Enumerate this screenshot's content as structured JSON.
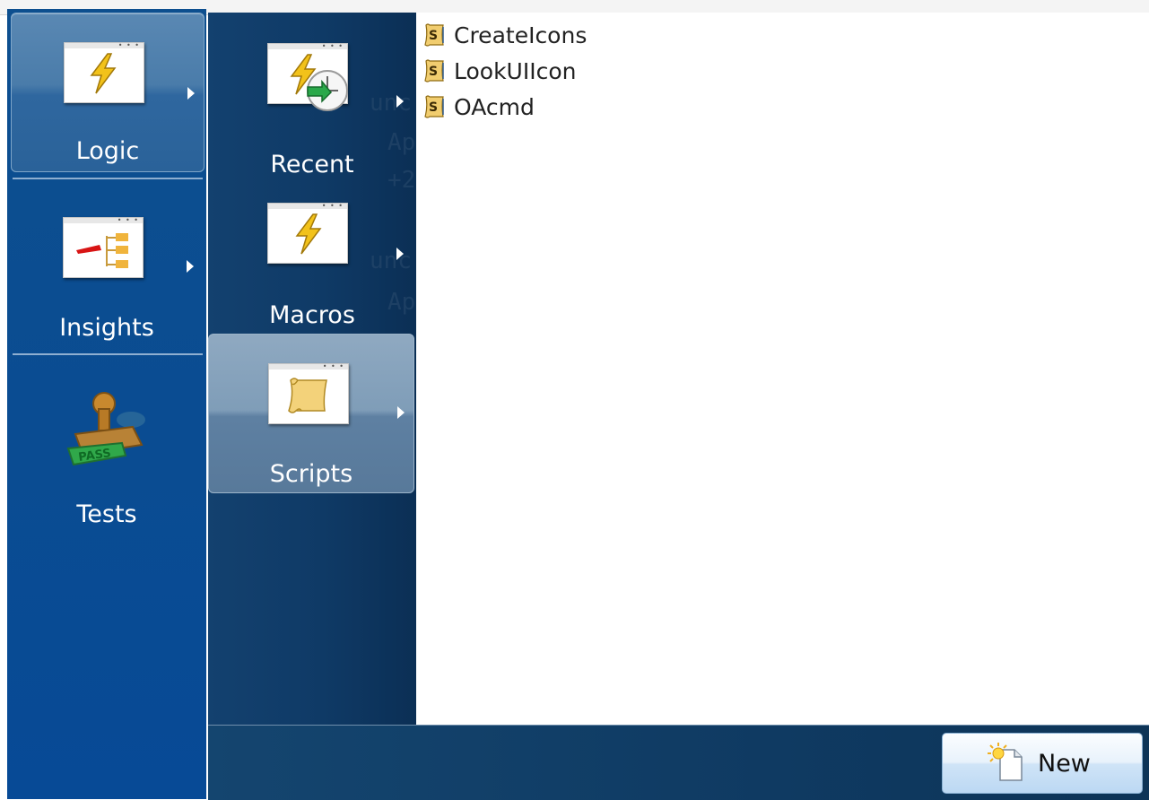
{
  "left_categories": [
    {
      "label": "Logic",
      "icon": "lightning-tile-icon",
      "selected": true
    },
    {
      "label": "Insights",
      "icon": "tree-chart-tile-icon",
      "selected": false
    },
    {
      "label": "Tests",
      "icon": "rubber-stamp-icon",
      "selected": false
    }
  ],
  "logic_submenu": [
    {
      "label": "Recent",
      "icon": "lightning-clock-tile-icon",
      "selected": false
    },
    {
      "label": "Macros",
      "icon": "lightning-tile-icon",
      "selected": false
    },
    {
      "label": "Scripts",
      "icon": "scroll-tile-icon",
      "selected": true
    }
  ],
  "scripts": [
    {
      "name": "CreateIcons",
      "icon": "script-scroll-icon"
    },
    {
      "name": "LookUIIcon",
      "icon": "script-scroll-icon"
    },
    {
      "name": "OAcmd",
      "icon": "script-scroll-icon"
    }
  ],
  "new_button": {
    "label": "New",
    "icon": "new-document-icon"
  },
  "stamp_text": "PASS",
  "colors": {
    "accent": "#0a4c92",
    "panel": "#0f3a66",
    "button_fill": "#cfe4f7"
  }
}
